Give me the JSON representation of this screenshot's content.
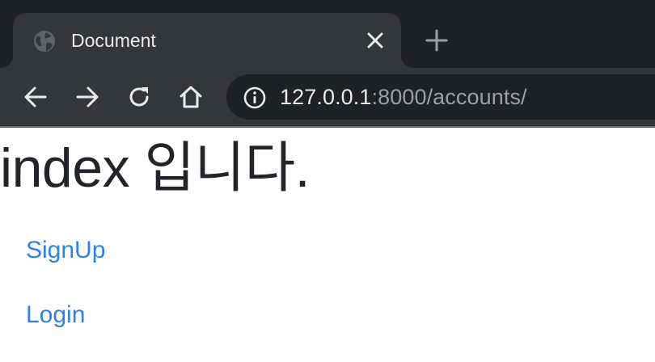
{
  "browser": {
    "tab": {
      "title": "Document",
      "favicon": "globe-icon",
      "close_icon": "close-icon"
    },
    "new_tab_icon": "plus-icon",
    "toolbar": {
      "back_icon": "arrow-left-icon",
      "forward_icon": "arrow-right-icon",
      "reload_icon": "reload-icon",
      "home_icon": "home-icon"
    },
    "address_bar": {
      "icon": "info-icon",
      "host": "127.0.0.1",
      "rest": ":8000/accounts/"
    }
  },
  "page": {
    "heading": "index 입니다.",
    "links": [
      {
        "label": "SignUp"
      },
      {
        "label": "Login"
      }
    ]
  },
  "colors": {
    "chrome_dark": "#202124",
    "chrome_tab": "#35363a",
    "chrome_text": "#e8eaed",
    "url_dim": "#9aa0a6",
    "heading_text": "#212529",
    "link": "#2f80ed"
  }
}
